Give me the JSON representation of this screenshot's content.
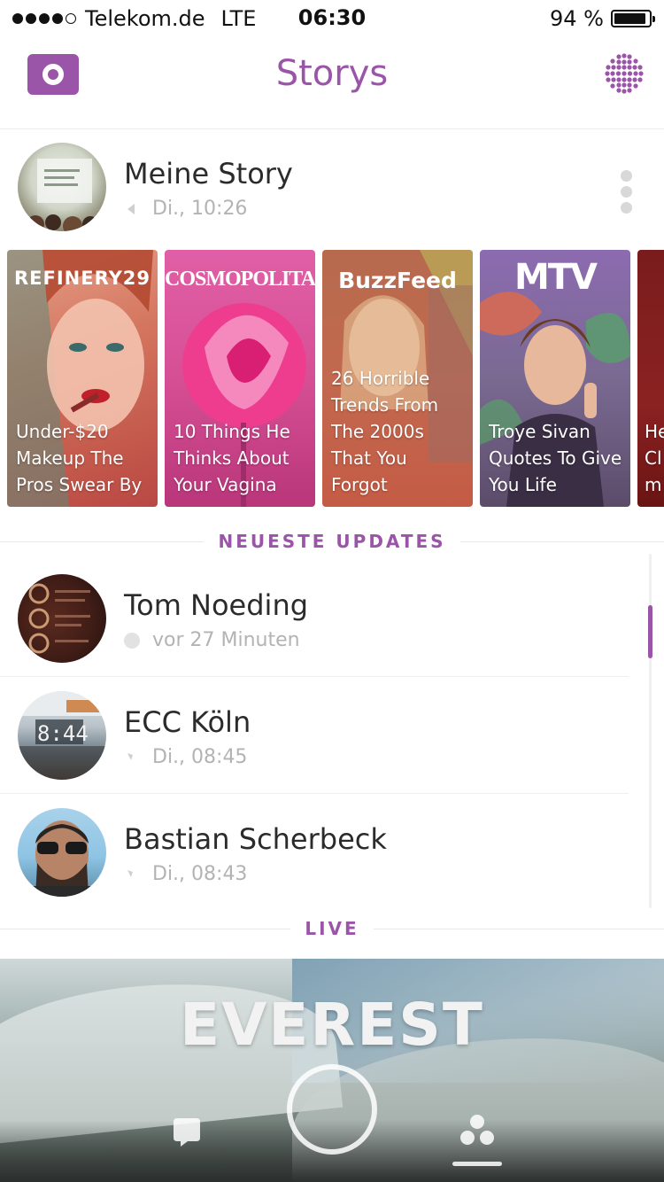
{
  "status_bar": {
    "carrier": "Telekom.de",
    "network": "LTE",
    "time": "06:30",
    "battery": "94 %"
  },
  "header": {
    "title": "Storys",
    "camera_icon": "camera-icon",
    "discover_icon": "discover-dots-icon"
  },
  "colors": {
    "accent": "#9b55a8",
    "muted": "#b3b3b3"
  },
  "my_story": {
    "name": "Meine Story",
    "time": "Di., 10:26"
  },
  "discover": [
    {
      "brand": "REFINERY29",
      "headline": "Under-$20 Makeup The Pros Swear By"
    },
    {
      "brand": "COSMOPOLITAN",
      "headline": "10 Things He Thinks About Your Vagina"
    },
    {
      "brand": "BuzzFeed",
      "headline": "26 Horrible Trends From The 2000s That You Forgot"
    },
    {
      "brand": "MTV",
      "headline": "Troye Sivan Quotes To Give You Life"
    },
    {
      "brand": "",
      "headline": "He Cl m"
    }
  ],
  "sections": {
    "recent": "NEUESTE UPDATES",
    "live": "LIVE"
  },
  "friends": [
    {
      "name": "Tom Noeding",
      "time": "vor 27 Minuten"
    },
    {
      "name": "ECC Köln",
      "time": "Di., 08:45"
    },
    {
      "name": "Bastian Scherbeck",
      "time": "Di., 08:43"
    }
  ],
  "live": {
    "title": "EVEREST"
  }
}
